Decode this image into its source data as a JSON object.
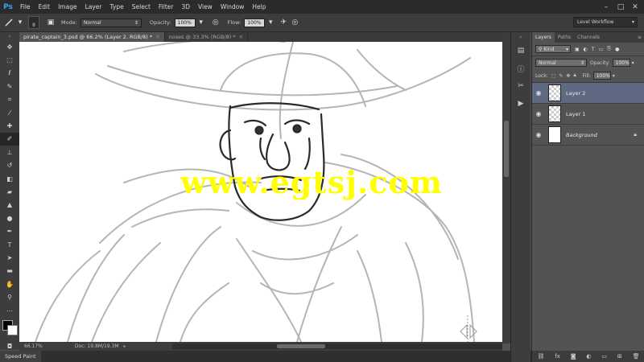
{
  "app": {
    "logo": "Ps",
    "menu": [
      "File",
      "Edit",
      "Image",
      "Layer",
      "Type",
      "Select",
      "Filter",
      "3D",
      "View",
      "Window",
      "Help"
    ],
    "window_controls": [
      "–",
      "□",
      "✕"
    ]
  },
  "options_bar": {
    "brush_size": "8",
    "mode_label": "Mode:",
    "mode_value": "Normal",
    "opacity_label": "Opacity:",
    "opacity_value": "100%",
    "flow_label": "Flow:",
    "flow_value": "100%",
    "workspace": "Level Workflow"
  },
  "document_tabs": [
    {
      "label": "pirate_captain_3.psd @ 66.2% (Layer 2, RGB/8) *",
      "active": true
    },
    {
      "label": "noses @ 33.3% (RGB/8) *",
      "active": false
    }
  ],
  "canvas": {
    "watermark": "www.egtsj.com"
  },
  "status": {
    "zoom": "66.17%",
    "doc_info": "Doc: 19.8M/19.3M"
  },
  "bottom_panel": {
    "speed_paint": "Speed Paint"
  },
  "layers_panel": {
    "tabs": [
      "Layers",
      "Paths",
      "Channels"
    ],
    "kind_label": "Kind",
    "blend_mode": "Normal",
    "opacity_label": "Opacity:",
    "opacity_value": "100%",
    "lock_label": "Lock:",
    "fill_label": "Fill:",
    "fill_value": "100%",
    "layers": [
      {
        "name": "Layer 2",
        "selected": true
      },
      {
        "name": "Layer 1",
        "selected": false
      },
      {
        "name": "Background",
        "selected": false
      }
    ]
  },
  "icons": {
    "toolbar": [
      "move-icon",
      "marquee-icon",
      "lasso-icon",
      "quick-select-icon",
      "crop-icon",
      "eyedropper-icon",
      "healing-icon",
      "brush-icon",
      "clone-stamp-icon",
      "history-brush-icon",
      "eraser-icon",
      "gradient-icon",
      "blur-icon",
      "dodge-icon",
      "pen-icon",
      "type-icon",
      "path-select-icon",
      "shape-icon",
      "hand-icon",
      "zoom-icon"
    ]
  },
  "colors": {
    "accent": "#31a8ff",
    "watermark": "#ffff00",
    "selected_layer": "#5f6a82"
  }
}
